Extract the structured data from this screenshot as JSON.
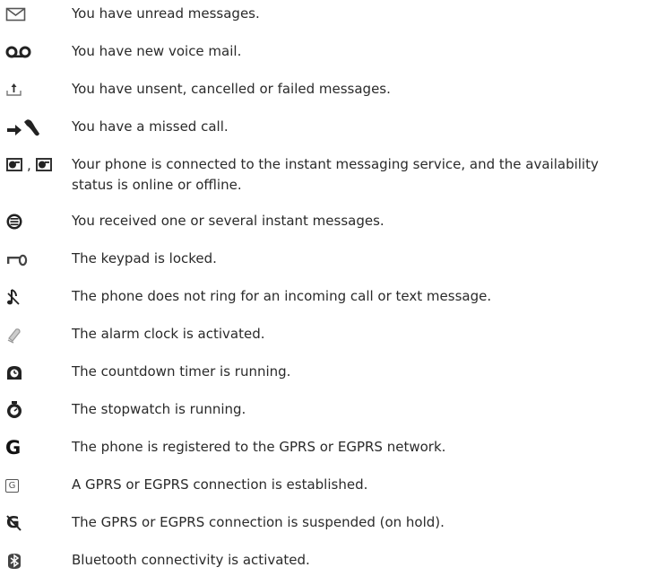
{
  "indicators": [
    {
      "icon": "envelope-icon",
      "text": "You have unread messages."
    },
    {
      "icon": "voicemail-icon",
      "text": "You have new voice mail."
    },
    {
      "icon": "outbox-upload-icon",
      "text": "You have unsent, cancelled or failed messages."
    },
    {
      "icon": "missed-call-icon",
      "text": "You have a missed call."
    },
    {
      "icon": "instant-messaging-status-icon",
      "icon_separator": ",",
      "text_line1": "Your phone is connected to the instant messaging service, and the availability",
      "text_line2": "status is online or offline."
    },
    {
      "icon": "chat-bubble-icon",
      "text": "You received one or several instant messages."
    },
    {
      "icon": "key-icon",
      "text": "The keypad is locked."
    },
    {
      "icon": "silent-note-icon",
      "text": "The phone does not ring for an incoming call or text message."
    },
    {
      "icon": "alarm-bell-icon",
      "text": "The alarm clock is activated."
    },
    {
      "icon": "countdown-timer-icon",
      "text": "The countdown timer is running."
    },
    {
      "icon": "stopwatch-icon",
      "text": "The stopwatch is running."
    },
    {
      "icon": "gprs-registered-icon",
      "icon_glyph": "G",
      "text": "The phone is registered to the GPRS or EGPRS network."
    },
    {
      "icon": "gprs-connected-icon",
      "icon_glyph": "G",
      "text": "A GPRS or EGPRS connection is established."
    },
    {
      "icon": "gprs-suspended-icon",
      "icon_glyph": "G",
      "text": "The GPRS or EGPRS connection is suspended (on hold)."
    },
    {
      "icon": "bluetooth-icon",
      "text": "Bluetooth connectivity is activated."
    }
  ]
}
